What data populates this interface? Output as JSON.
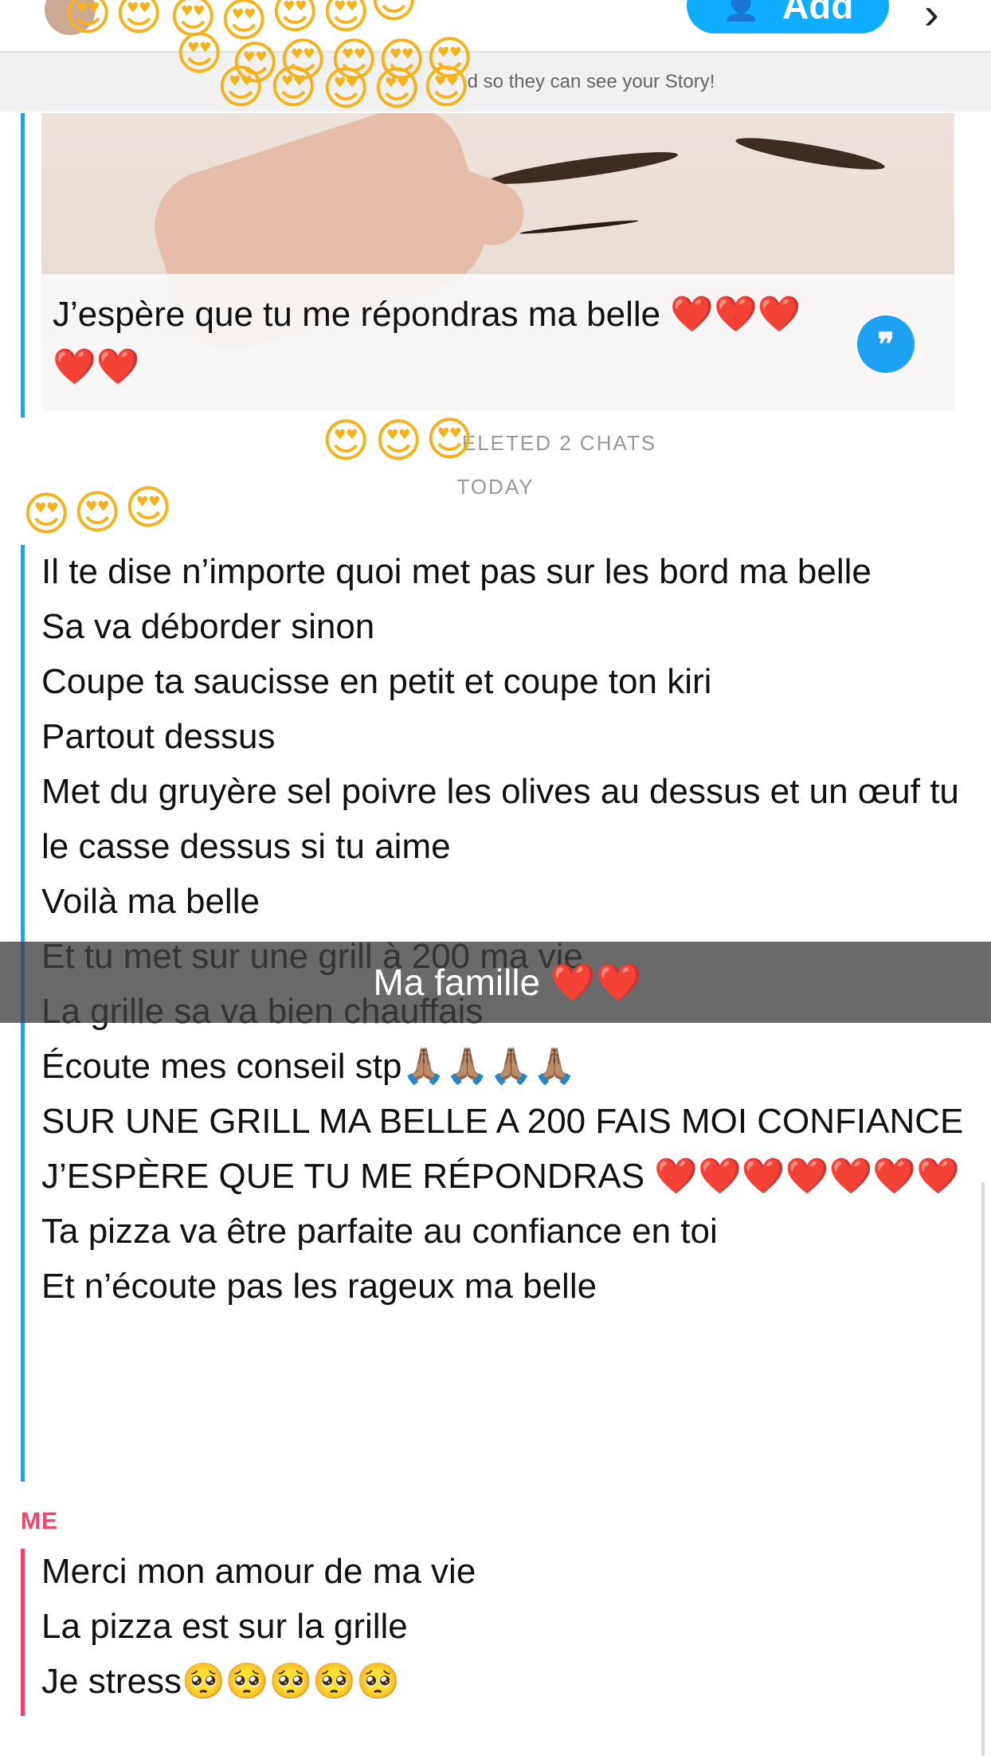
{
  "header": {
    "add_label": "Add",
    "banner_text": "d so they can see your Story!"
  },
  "snap": {
    "caption": "J’espère que tu me répondras ma belle ❤️❤️❤️❤️❤️"
  },
  "system": {
    "deleted_text": "ELETED 2 CHATS",
    "day_label": "TODAY"
  },
  "friend_messages": [
    "Il te dise n’importe quoi met pas sur les bord ma belle",
    "Sa va déborder sinon",
    "Coupe ta saucisse en petit et coupe ton kiri",
    "Partout dessus",
    "Met du gruyère sel poivre les olives au dessus et un œuf tu le casse dessus si tu aime",
    "Voilà ma belle",
    "Et tu met sur une grill à 200 ma vie",
    "La grille sa va bien chauffais",
    "Écoute mes conseil stp🙏🏽🙏🏽🙏🏽🙏🏽",
    "SUR UNE GRILL MA BELLE A 200 FAIS MOI CONFIANCE",
    "J’ESPÈRE QUE TU ME RÉPONDRAS ❤️❤️❤️❤️❤️❤️❤️",
    "Ta pizza va être parfaite au confiance en toi",
    "Et n’écoute pas les rageux ma belle"
  ],
  "me": {
    "label": "ME",
    "messages": [
      "Merci mon amour de ma vie",
      "La pizza est sur la grille",
      "Je stress🥺🥺🥺🥺🥺"
    ]
  },
  "overlay_caption": "Ma famille ❤️❤️",
  "colors": {
    "friend_accent": "#2e9bf0",
    "me_accent": "#f2446a",
    "add_button": "#0fadff"
  },
  "icons": {
    "sticker": "heart-eyes-emoji",
    "reply": "quote-icon",
    "add": "add-friend-icon",
    "more": "chevron-icon"
  }
}
